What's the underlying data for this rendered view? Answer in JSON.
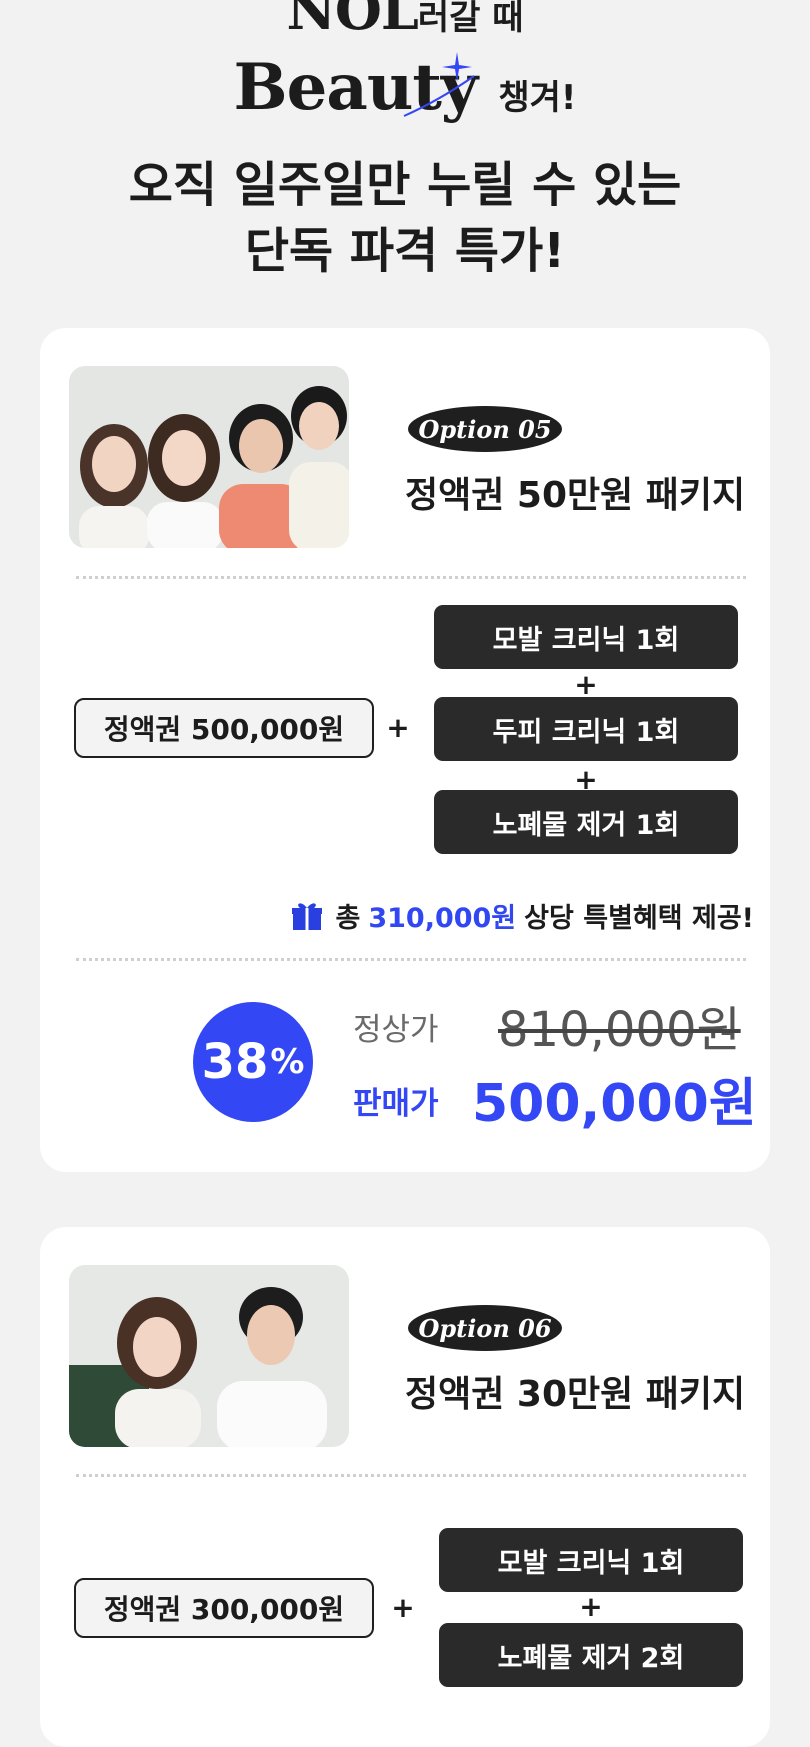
{
  "hero": {
    "logo_line1_en": "NOL",
    "logo_line1_ko": "러갈 때",
    "logo_line2_en": "Beauty",
    "logo_line2_ko": "챙겨!",
    "headline_line1": "오직 일주일만 누릴 수 있는",
    "headline_line2": "단독 파격 특가!"
  },
  "packages": [
    {
      "option": "Option 05",
      "title": "정액권 50만원 패키지",
      "voucher": "정액권 500,000원",
      "plus": "+",
      "benefits": [
        "모발 크리닉 1회",
        "두피 크리닉 1회",
        "노폐물 제거 1회"
      ],
      "gift_prefix": "총",
      "gift_amount": "310,000원",
      "gift_suffix": "상당 특별혜택 제공!",
      "discount_value": "38",
      "discount_unit": "%",
      "regular_label": "정상가",
      "regular_price": "810,000원",
      "sale_label": "판매가",
      "sale_price": "500,000원"
    },
    {
      "option": "Option 06",
      "title": "정액권 30만원 패키지",
      "voucher": "정액권 300,000원",
      "plus": "+",
      "benefits": [
        "모발 크리닉 1회",
        "노폐물 제거 2회"
      ]
    }
  ],
  "colors": {
    "accent_blue": "#3347f5",
    "pill_dark": "#2a2a2a",
    "background": "#f2f2f2"
  },
  "icons": [
    "sparkle-icon",
    "gift-icon"
  ]
}
